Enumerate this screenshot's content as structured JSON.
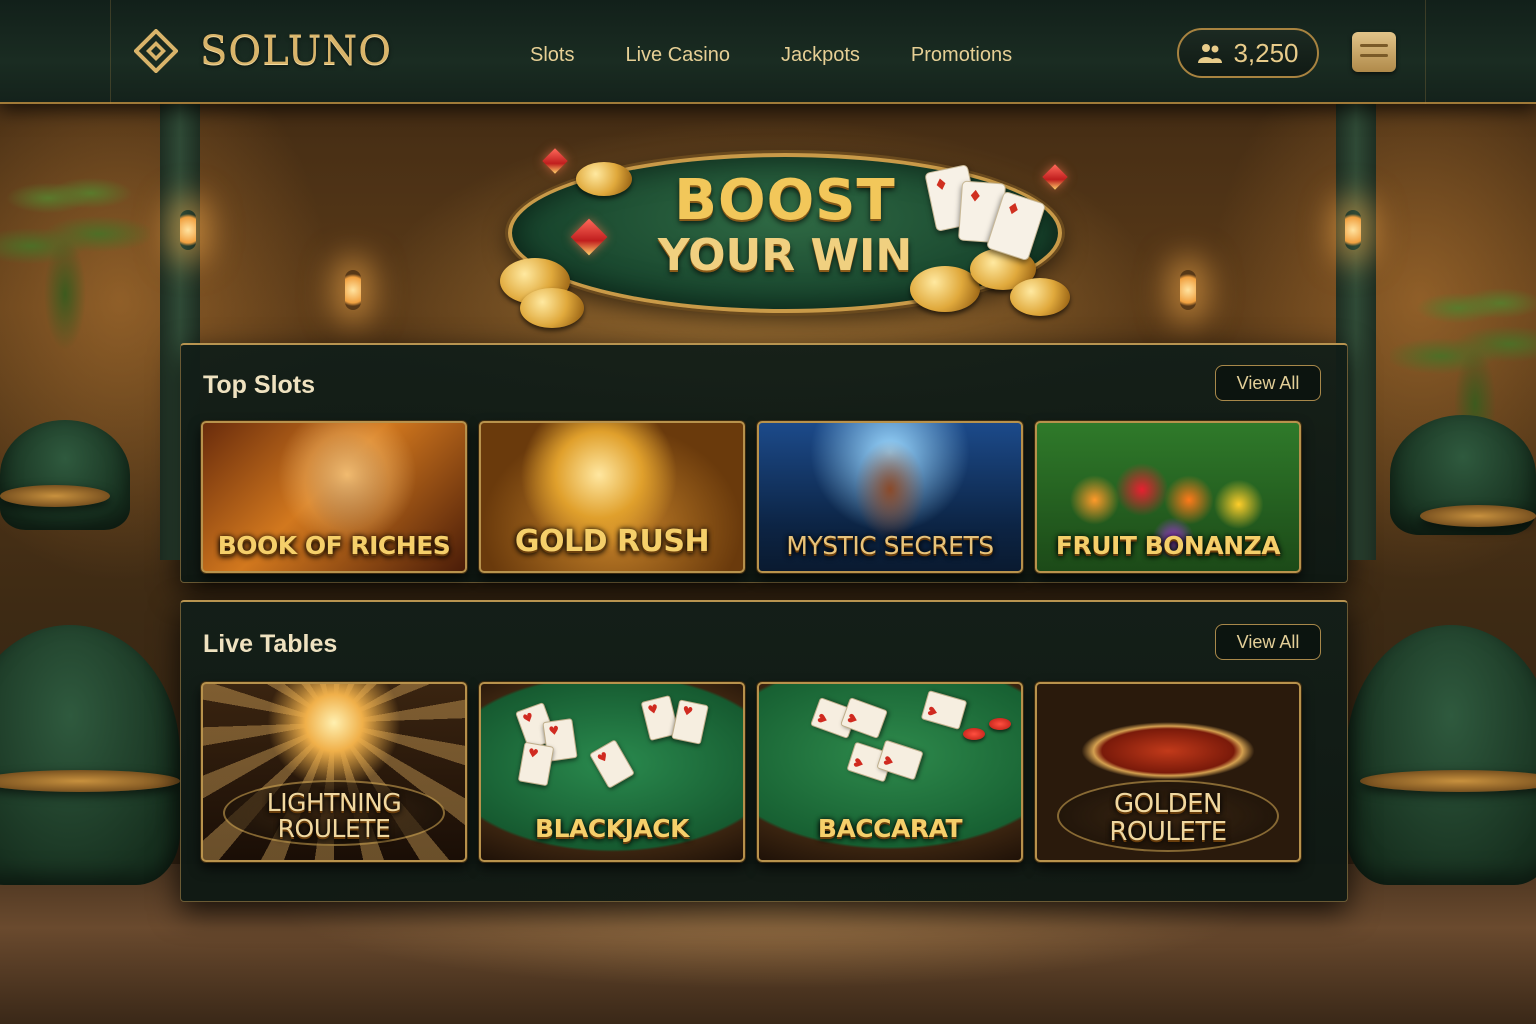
{
  "brand": {
    "name": "SOLUNO"
  },
  "nav": {
    "links": [
      "Slots",
      "Live Casino",
      "Jackpots",
      "Promotions"
    ]
  },
  "account": {
    "balance": "3,250"
  },
  "banner": {
    "line1": "BOOST",
    "line2": "YOUR WIN"
  },
  "sections": {
    "top_slots": {
      "title": "Top Slots",
      "view_all": "View All",
      "games": [
        "BOOK OF RICHES",
        "GOLD RUSH",
        "MYSTIC SECRETS",
        "FRUIT BONANZA"
      ]
    },
    "live_tables": {
      "title": "Live Tables",
      "view_all": "View All",
      "games": [
        {
          "line1": "LIGHTNING",
          "line2": "ROULETE"
        },
        {
          "line1": "BLACKJACK",
          "line2": ""
        },
        {
          "line1": "BACCARAT",
          "line2": ""
        },
        {
          "line1": "GOLDEN",
          "line2": "ROULETE"
        }
      ]
    }
  },
  "icons": {
    "logo": "diamond-logo-icon",
    "balance": "users-icon",
    "wallet": "wallet-icon"
  },
  "colors": {
    "gold": "#d9b46a",
    "panel": "#12201a",
    "accent_green": "#2f6a44"
  }
}
